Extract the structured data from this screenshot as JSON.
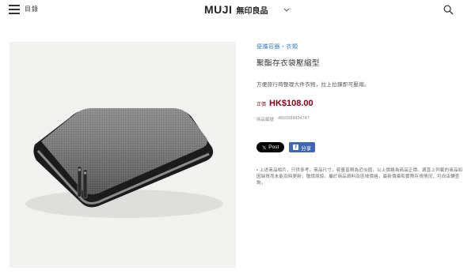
{
  "header": {
    "menu_label": "目錄",
    "logo_en": "MUJI",
    "logo_jp": "無印良品"
  },
  "breadcrumb": {
    "label": "便攜容器・衣類"
  },
  "product": {
    "title": "聚酯存衣袋壓縮型",
    "description": "方便旅行時整理大件衣物，拉上拉鍊即可壓縮。",
    "price_tag": "正價",
    "price": "HK$108.00",
    "code_label": "商品編號",
    "code_value": "4550584434747"
  },
  "share": {
    "post_label": "Post",
    "facebook_label": "分享"
  },
  "note": "• 上述商品相片，只供參考。商品尺寸，容量皆剛為近似值，以上價格為商品正價。適直上列載的商品如因缺貨而未能及時更新，敬請原諒。屬於商品資料及區域價格，最新價庫和實際存貨情況，可向店鋪查詢。",
  "colors": {
    "price": "#7f0019",
    "link": "#3a7bc8",
    "facebook": "#4267b2"
  },
  "icons": [
    "menu-icon",
    "chevron-down-icon",
    "search-icon",
    "x-icon",
    "facebook-icon"
  ]
}
